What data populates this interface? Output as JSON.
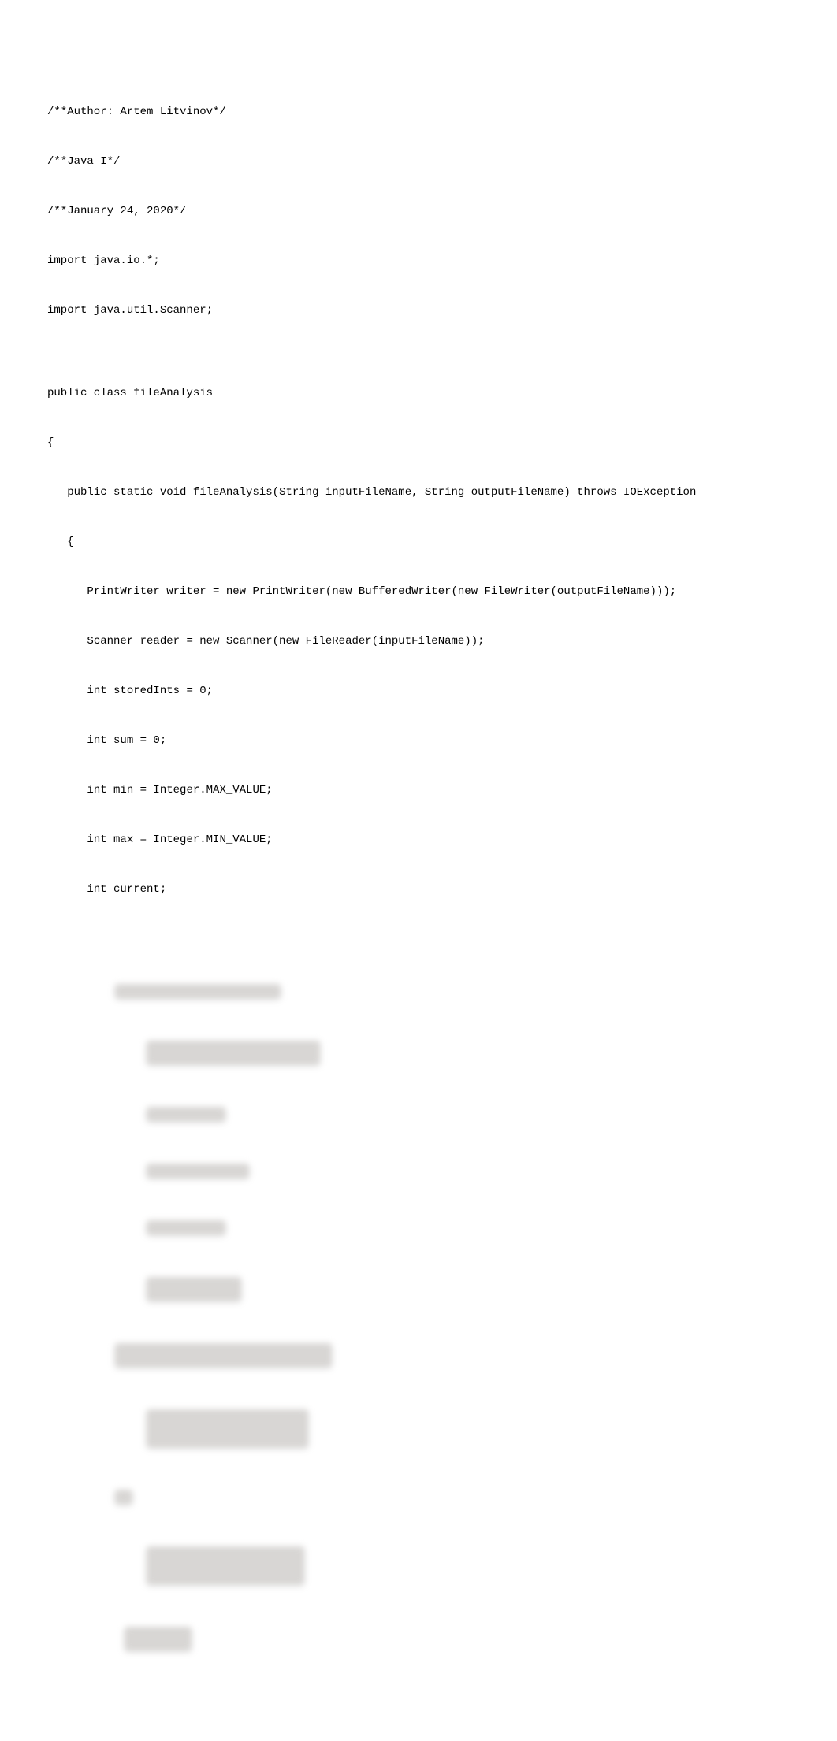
{
  "code": {
    "line1": "/**Author: Artem Litvinov*/",
    "line2": "/**Java I*/",
    "line3": "/**January 24, 2020*/",
    "line4": "import java.io.*;",
    "line5": "import java.util.Scanner;",
    "line6": "",
    "line7": "public class fileAnalysis",
    "line8": "{",
    "line9": "   public static void fileAnalysis(String inputFileName, String outputFileName) throws IOException",
    "line10": "   {",
    "line11": "      PrintWriter writer = new PrintWriter(new BufferedWriter(new FileWriter(outputFileName)));",
    "line12": "      Scanner reader = new Scanner(new FileReader(inputFileName));",
    "line13": "      int storedInts = 0;",
    "line14": "      int sum = 0;",
    "line15": "      int min = Integer.MAX_VALUE;",
    "line16": "      int max = Integer.MIN_VALUE;",
    "line17": "      int current;"
  }
}
